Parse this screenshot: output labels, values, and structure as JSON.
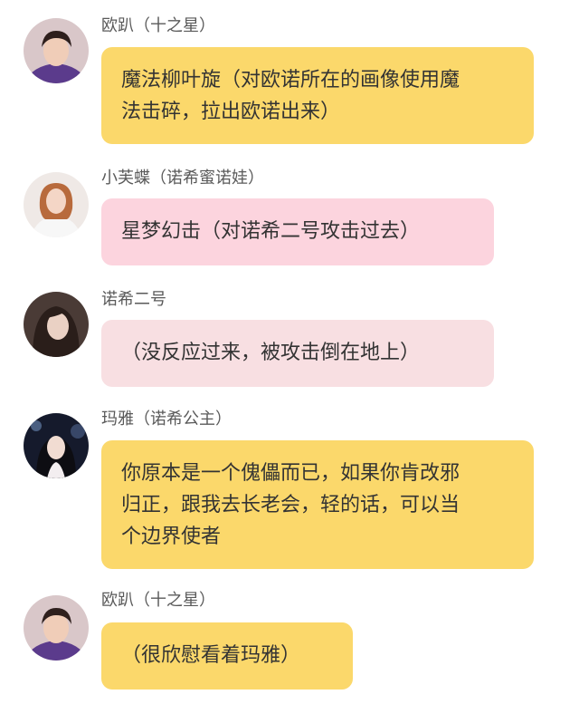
{
  "colors": {
    "yellow_bubble": "#fbd86b",
    "pink_bubble": "#fcd4de",
    "light_pink_bubble": "#f8dfe2",
    "name_text": "#5a5a5a",
    "message_text": "#333333"
  },
  "messages": [
    {
      "sender": "欧趴（十之星）",
      "text": "魔法柳叶旋（对欧诺所在的画像使用魔\n法击碎，拉出欧诺出来）",
      "bubble_color": "yellow",
      "avatar": "boy-avatar"
    },
    {
      "sender": "小芙蝶（诺希蜜诺娃）",
      "text": "星梦幻击（对诺希二号攻击过去）",
      "bubble_color": "pink",
      "avatar": "girl-white-avatar"
    },
    {
      "sender": "诺希二号",
      "text": "（没反应过来，被攻击倒在地上）",
      "bubble_color": "light-pink",
      "avatar": "girl-dark-avatar"
    },
    {
      "sender": "玛雅（诺希公主）",
      "text": "你原本是一个傀儡而已，如果你肯改邪\n归正，跟我去长老会，轻的话，可以当\n个边界使者",
      "bubble_color": "yellow",
      "avatar": "girl-night-avatar"
    },
    {
      "sender": "欧趴（十之星）",
      "text": "（很欣慰看着玛雅）",
      "bubble_color": "yellow",
      "avatar": "boy-avatar"
    }
  ]
}
